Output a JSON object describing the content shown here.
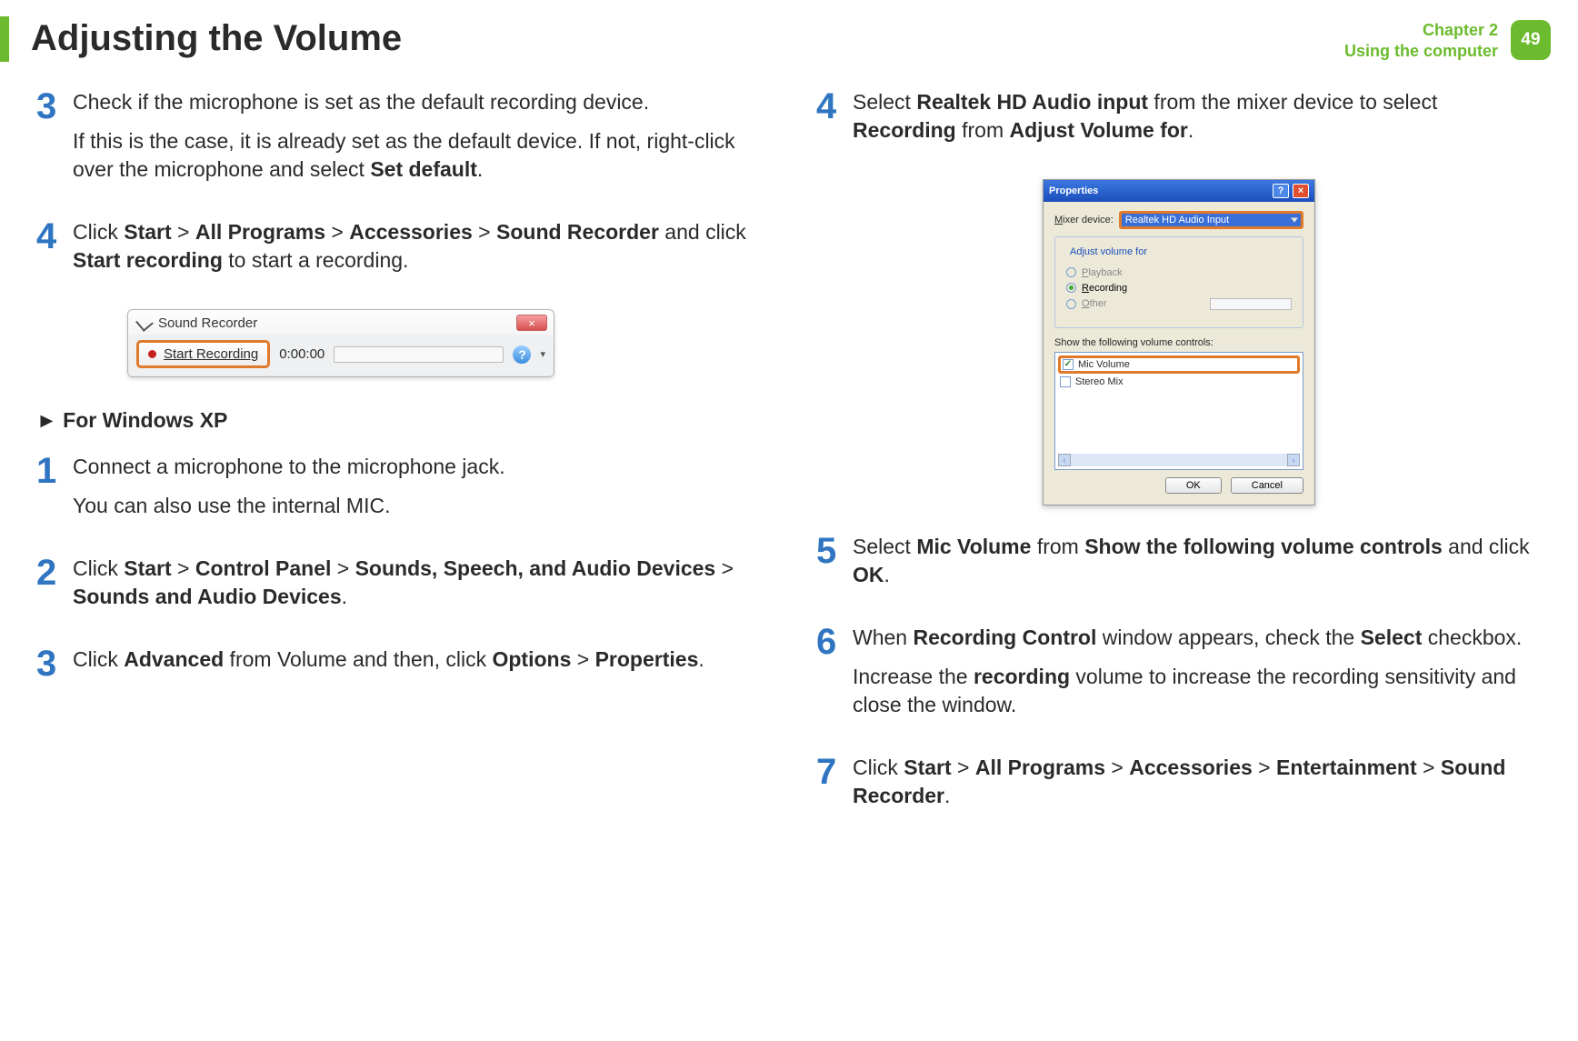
{
  "header": {
    "title": "Adjusting the Volume",
    "chapter_line1": "Chapter 2",
    "chapter_line2": "Using the computer",
    "page_number": "49"
  },
  "left_steps": {
    "s3_num": "3",
    "s3_p1": "Check if the microphone is set as the default recording device.",
    "s3_p2a": "If this is the case, it is already set as the default device. If not, right-click over the microphone and select ",
    "s3_p2_bold": "Set default",
    "s3_p2b": ".",
    "s4_num": "4",
    "s4_p_prefix": "Click ",
    "s4_b1": "Start",
    "gt": " > ",
    "s4_b2": "All Programs",
    "s4_b3": "Accessories",
    "s4_b4": "Sound Recorder",
    "s4_mid": " and click ",
    "s4_b5": "Start recording",
    "s4_suffix": " to start a recording."
  },
  "sound_recorder": {
    "window_title": "Sound Recorder",
    "button_label": "Start Recording",
    "time": "0:00:00",
    "close": "×",
    "help": "?",
    "dropdown": "▾"
  },
  "xp_section_title": "►  For Windows XP",
  "xp_left": {
    "s1_num": "1",
    "s1_p1": "Connect a microphone to the microphone jack.",
    "s1_p2": "You can also use the internal MIC.",
    "s2_num": "2",
    "s2_prefix": "Click ",
    "s2_b1": "Start",
    "s2_b2": "Control Panel",
    "s2_b3": "Sounds, Speech, and Audio Devices",
    "s2_b4": "Sounds and Audio Devices",
    "period": ".",
    "s3_num": "3",
    "s3_prefix": "Click ",
    "s3_b1": "Advanced",
    "s3_mid": " from Volume and then, click ",
    "s3_b2": "Options",
    "s3_b3": "Properties"
  },
  "right": {
    "s4_num": "4",
    "s4_prefix": "Select ",
    "s4_b1": "Realtek HD Audio input",
    "s4_mid1": " from the mixer device to select ",
    "s4_b2": "Recording",
    "s4_mid2": " from ",
    "s4_b3": "Adjust Volume for",
    "period": ".",
    "s5_num": "5",
    "s5_prefix": "Select ",
    "s5_b1": "Mic Volume",
    "s5_mid1": " from ",
    "s5_b2": "Show the following volume controls",
    "s5_mid2": " and click ",
    "s5_b3": "OK",
    "s6_num": "6",
    "s6_prefix": "When ",
    "s6_b1": "Recording Control",
    "s6_mid": " window appears, check the ",
    "s6_b2": "Select",
    "s6_suffix": " checkbox.",
    "s6_p2a": "Increase the ",
    "s6_p2_bold": "recording",
    "s6_p2b": " volume to increase the recording sensitivity and close the window.",
    "s7_num": "7",
    "s7_prefix": "Click ",
    "s7_b1": "Start",
    "s7_b2": "All Programs",
    "s7_b3": "Accessories",
    "s7_b4": "Entertainment",
    "s7_b5": "Sound Recorder"
  },
  "xp_window": {
    "title": "Properties",
    "help": "?",
    "close": "×",
    "mixer_label": "Mixer device:",
    "mixer_value": "Realtek HD Audio Input",
    "group_title": "Adjust volume for",
    "radio_playback": "Playback",
    "radio_recording": "Recording",
    "radio_other": "Other",
    "list_label": "Show the following volume controls:",
    "list_items": [
      {
        "label": "Mic Volume",
        "checked": true,
        "highlight": true
      },
      {
        "label": "Stereo Mix",
        "checked": false,
        "highlight": false
      }
    ],
    "btn_ok": "OK",
    "btn_cancel": "Cancel",
    "scroll_left": "‹",
    "scroll_right": "›"
  }
}
